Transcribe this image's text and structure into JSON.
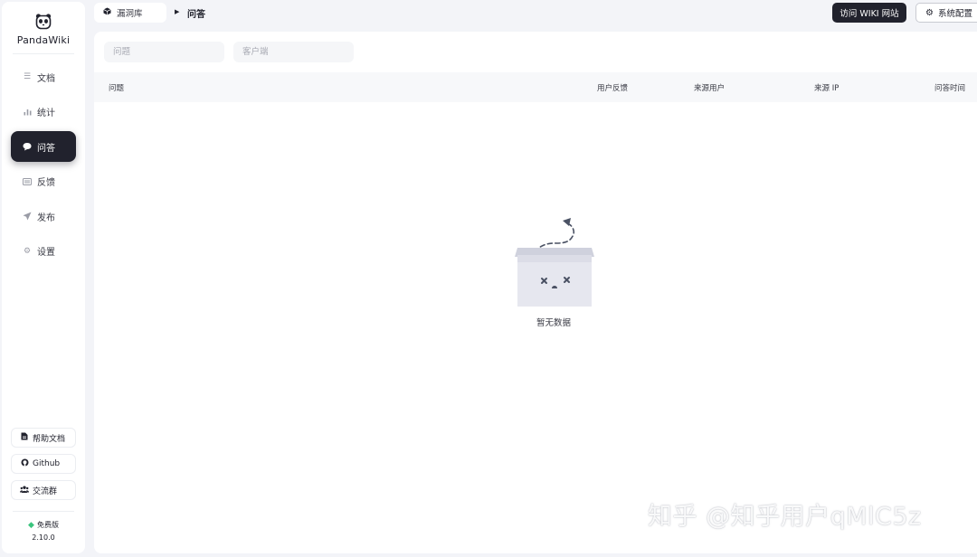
{
  "brand": {
    "name": "PandaWiki",
    "logo_icon": "panda-icon"
  },
  "nav": {
    "items": [
      {
        "label": "文档",
        "icon": "layers-icon"
      },
      {
        "label": "统计",
        "icon": "bar-chart-icon"
      },
      {
        "label": "问答",
        "icon": "chat-bubble-icon",
        "active": true
      },
      {
        "label": "反馈",
        "icon": "keyboard-icon"
      },
      {
        "label": "发布",
        "icon": "send-icon"
      },
      {
        "label": "设置",
        "icon": "gear-icon"
      }
    ]
  },
  "side_links": [
    {
      "label": "帮助文档",
      "icon": "file-icon"
    },
    {
      "label": "Github",
      "icon": "github-icon"
    },
    {
      "label": "交流群",
      "icon": "group-icon"
    }
  ],
  "version": {
    "tier": "免费版",
    "number": "2.10.0"
  },
  "breadcrumb": {
    "root": "漏洞库",
    "current": "问答"
  },
  "header": {
    "visit_button": "访问 WIKI 网站",
    "settings_button": "系统配置"
  },
  "filters": {
    "question_placeholder": "问题",
    "client_placeholder": "客户端"
  },
  "table": {
    "columns": [
      "问题",
      "用户反馈",
      "来源用户",
      "来源 IP",
      "问答时间"
    ],
    "empty_text": "暂无数据"
  },
  "watermark": "知乎 @知乎用户qMlC5z",
  "colors": {
    "accent": "#21222d",
    "background": "#f3f4f8",
    "free_badge": "#3ac47d"
  }
}
